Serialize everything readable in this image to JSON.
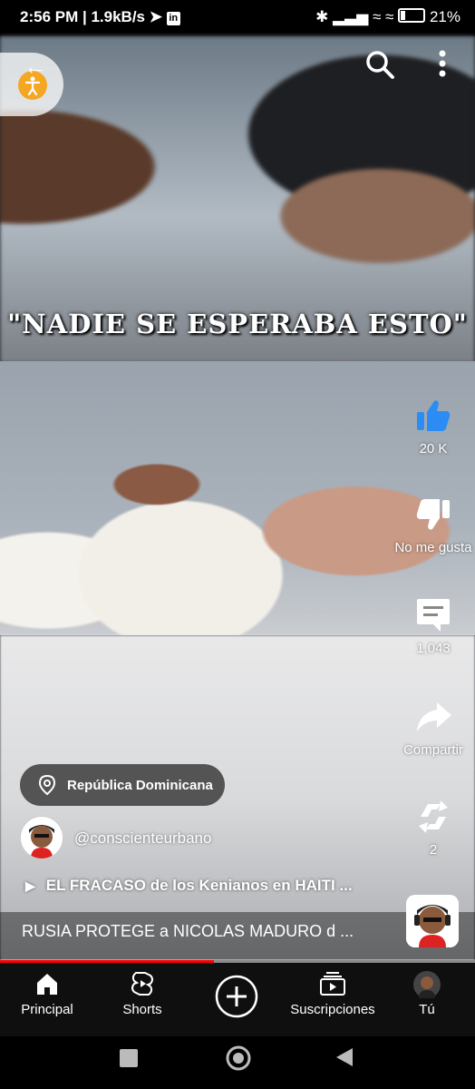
{
  "status_bar": {
    "time_info": "2:56 PM | 1.9kB/s",
    "battery": "21%"
  },
  "video": {
    "caption": "\"NADIE SE ESPERABA ESTO\"",
    "progress_fraction": 0.45
  },
  "actions": {
    "like_count": "20 K",
    "dislike_label": "No me gusta",
    "comments_count": "1,043",
    "share_label": "Compartir",
    "remix_count": "2"
  },
  "info": {
    "location": "República Dominicana",
    "channel": "@conscienteurbano",
    "playlist": "EL FRACASO de los Kenianos en HAITI ...",
    "title": "RUSIA PROTEGE a NICOLAS MADURO d ..."
  },
  "nav": {
    "home": "Principal",
    "shorts": "Shorts",
    "subscriptions": "Suscripciones",
    "you": "Tú"
  },
  "colors": {
    "accent": "#ff0000",
    "like_blue": "#2b8cf3",
    "a11y_orange": "#f5a623"
  }
}
